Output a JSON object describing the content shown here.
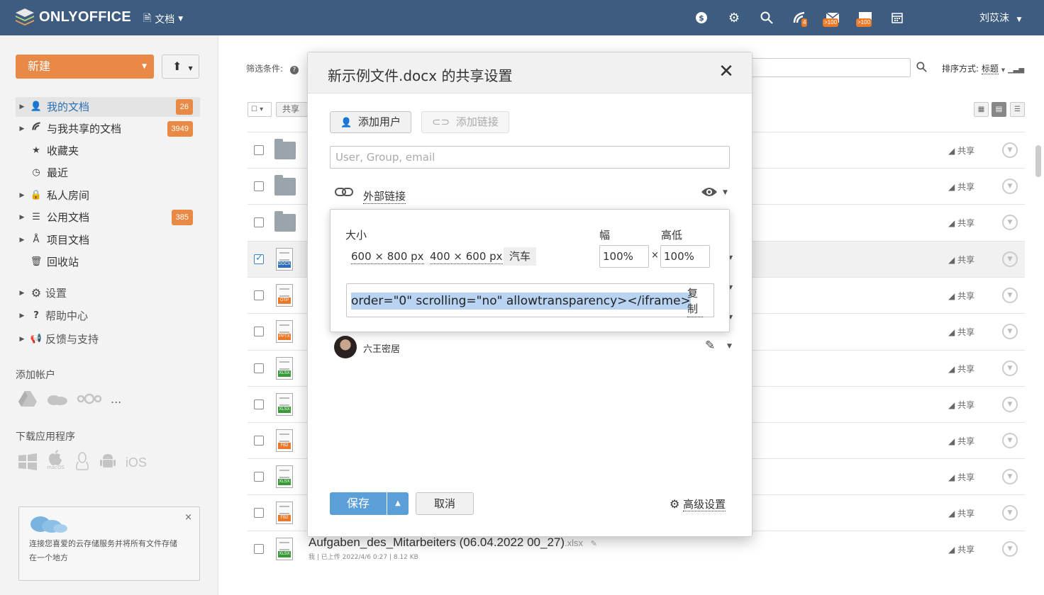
{
  "topbar": {
    "logo_text": "ONLYOFFICE",
    "docs_menu": "文档",
    "badges": {
      "feed": "4",
      "mail": ">100",
      "talk": ">100"
    },
    "username": "刘苡沫"
  },
  "sidebar": {
    "new_button": "新建",
    "items": [
      {
        "label": "我的文档",
        "badge": "26",
        "icon": "user-icon"
      },
      {
        "label": "与我共享的文档",
        "badge": "3949",
        "icon": "share-icon"
      },
      {
        "label": "收藏夹",
        "badge": "",
        "icon": "star-icon"
      },
      {
        "label": "最近",
        "badge": "",
        "icon": "clock-icon"
      },
      {
        "label": "私人房间",
        "badge": "",
        "icon": "lock-icon"
      },
      {
        "label": "公用文档",
        "badge": "385",
        "icon": "stack-icon"
      },
      {
        "label": "项目文档",
        "badge": "",
        "icon": "project-icon"
      },
      {
        "label": "回收站",
        "badge": "",
        "icon": "trash-icon"
      }
    ],
    "settings": "设置",
    "help": "帮助中心",
    "feedback": "反馈与支持",
    "add_account": "添加帐户",
    "account_more": "...",
    "download_apps": "下载应用程序",
    "macos_label": "macOS",
    "ios_label": "iOS",
    "promo_text": "连接您喜爱的云存储服务并将所有文件存储在一个地方",
    "promo_close": "×"
  },
  "main": {
    "filter_label": "筛选条件:",
    "sort_label": "排序方式:",
    "sort_value": "标题",
    "share_tab": "共享设",
    "share_text": "共享",
    "rows": [
      {
        "type": "folder",
        "checked": false
      },
      {
        "type": "folder",
        "checked": false
      },
      {
        "type": "folder",
        "checked": false
      },
      {
        "type": "doc",
        "ext": "DOCX",
        "color": "#2b6fb6",
        "checked": true
      },
      {
        "type": "doc",
        "ext": "OTP",
        "color": "#e8782a",
        "checked": false
      },
      {
        "type": "doc",
        "ext": "PPTX",
        "color": "#e8782a",
        "checked": false
      },
      {
        "type": "doc",
        "ext": "XLSX",
        "color": "#3a9a3a",
        "checked": false
      },
      {
        "type": "doc",
        "ext": "XLSX",
        "color": "#3a9a3a",
        "checked": false
      },
      {
        "type": "doc",
        "ext": "FB2",
        "color": "#e8782a",
        "checked": false
      },
      {
        "type": "doc",
        "ext": "XLSX",
        "color": "#3a9a3a",
        "checked": false
      },
      {
        "type": "doc",
        "ext": "FB2",
        "color": "#e8782a",
        "checked": false
      },
      {
        "type": "doc",
        "ext": "XLSX",
        "color": "#3a9a3a",
        "checked": false
      }
    ],
    "last_file": {
      "name": "Aufgaben_des_Mitarbeiters (06.04.2022 00_27)",
      "ext": ".xlsx",
      "meta": "我 | 已上传 2022/4/6 0:27 | 8.12 KB"
    }
  },
  "dialog": {
    "title": "新示例文件.docx 的共享设置",
    "add_user": "添加用户",
    "add_link": "添加链接",
    "user_placeholder": "User, Group, email",
    "external_link": "外部链接",
    "embed": {
      "size_label": "大小",
      "width_label": "幅",
      "height_label": "高低",
      "size_options": [
        "600 × 800 px",
        "400 × 600 px",
        "汽车"
      ],
      "width_value": "100%",
      "times": "×",
      "height_value": "100%",
      "code": "order=\"0\" scrolling=\"no\" allowtransparency></iframe>",
      "copy": "复制"
    },
    "user_name": "六王密居",
    "save": "保存",
    "cancel": "取消",
    "advanced": "高级设置"
  }
}
